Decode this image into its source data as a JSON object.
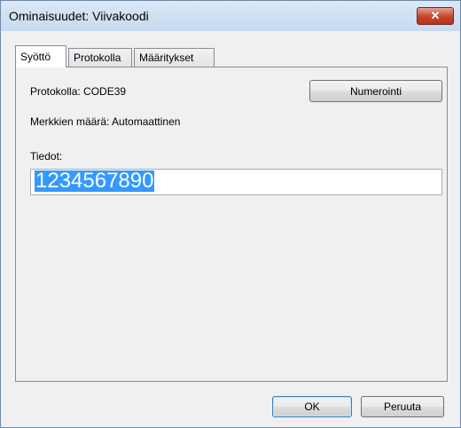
{
  "window": {
    "title": "Ominaisuudet: Viivakoodi",
    "close_icon": "close-icon"
  },
  "tabs": [
    {
      "label": "Syöttö",
      "active": true
    },
    {
      "label": "Protokolla",
      "active": false
    },
    {
      "label": "Määritykset",
      "active": false
    }
  ],
  "panel": {
    "protocol_label": "Protokolla: CODE39",
    "char_count_label": "Merkkien määrä: Automaattinen",
    "numbering_button": "Numerointi",
    "data_label": "Tiedot:",
    "data_value": "1234567890"
  },
  "footer": {
    "ok_label": "OK",
    "cancel_label": "Peruuta"
  }
}
